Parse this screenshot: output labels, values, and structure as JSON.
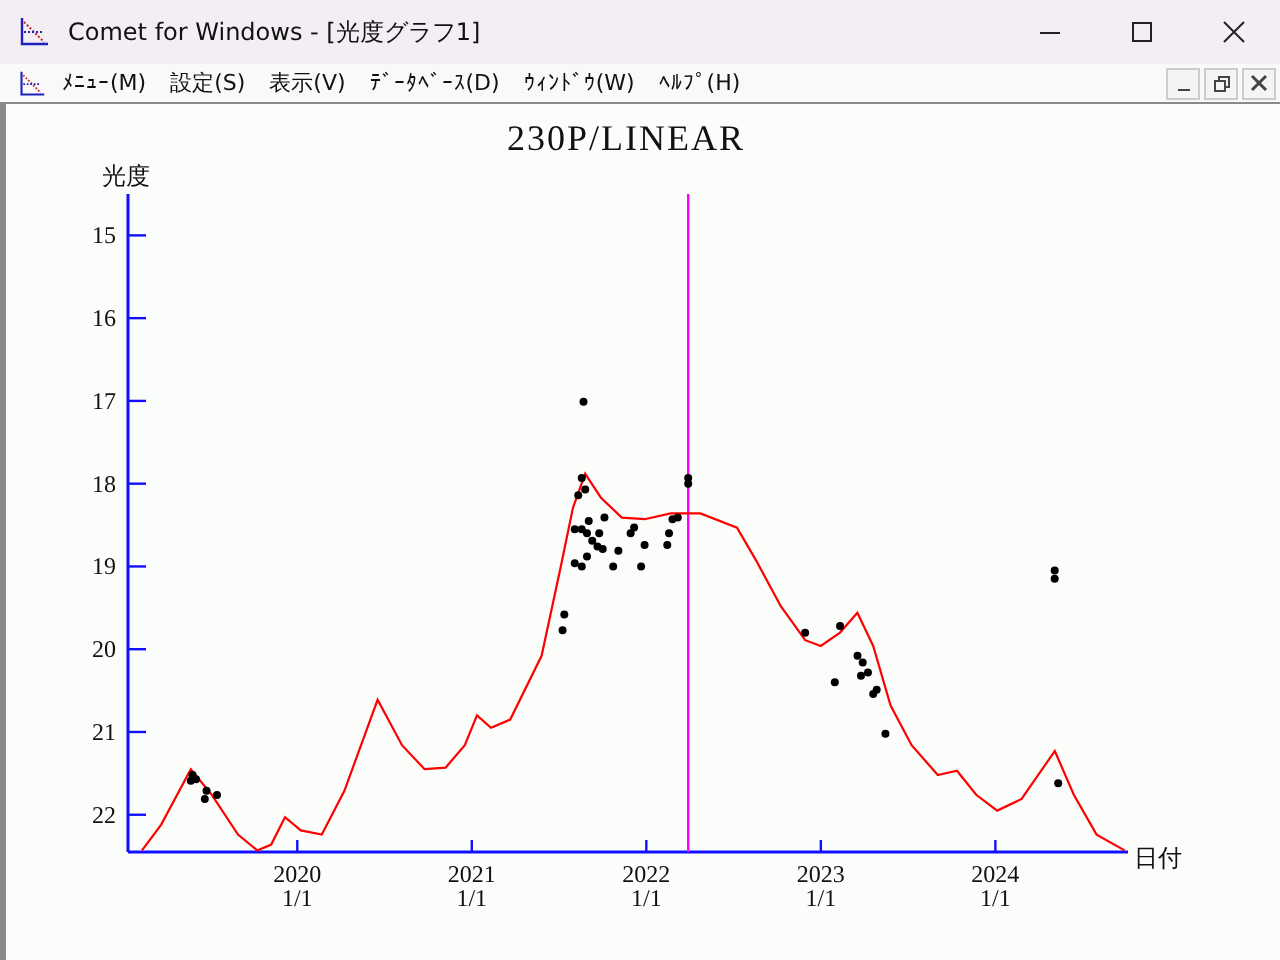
{
  "window": {
    "title": "Comet for Windows - [光度グラフ1]"
  },
  "menu": [
    "ﾒﾆｭｰ(M)",
    "設定(S)",
    "表示(V)",
    "ﾃﾞｰﾀﾍﾞｰｽ(D)",
    "ｳｨﾝﾄﾞｳ(W)",
    "ﾍﾙﾌﾟ(H)"
  ],
  "graph": {
    "chart_data": {
      "type": "line",
      "title": "230P/LINEAR",
      "ylabel": "光度",
      "xlabel": "日付",
      "xlim": [
        2019.03,
        2024.76
      ],
      "ylim": [
        22.45,
        14.5
      ],
      "xticks": [
        2020,
        2021,
        2022,
        2023,
        2024
      ],
      "yticks": [
        15,
        16,
        17,
        18,
        19,
        20,
        21,
        22
      ],
      "series": [
        {
          "color": "#ff0000",
          "x": [
            2019.11,
            2019.22,
            2019.39,
            2019.51,
            2019.66,
            2019.77,
            2019.85,
            2019.93,
            2020.02,
            2020.14,
            2020.27,
            2020.46,
            2020.6,
            2020.73,
            2020.85,
            2020.96,
            2021.03,
            2021.11,
            2021.22,
            2021.4,
            2021.51,
            2021.58,
            2021.65,
            2021.74,
            2021.86,
            2021.99,
            2022.14,
            2022.31,
            2022.52,
            2022.63,
            2022.77,
            2022.91,
            2023.0,
            2023.11,
            2023.21,
            2023.3,
            2023.4,
            2023.52,
            2023.67,
            2023.78,
            2023.89,
            2024.01,
            2024.15,
            2024.34,
            2024.45,
            2024.58,
            2024.74
          ],
          "values": [
            22.43,
            22.12,
            21.45,
            21.76,
            22.24,
            22.43,
            22.36,
            22.03,
            22.19,
            22.24,
            21.71,
            20.61,
            21.16,
            21.45,
            21.43,
            21.16,
            20.8,
            20.95,
            20.85,
            20.08,
            19.0,
            18.29,
            17.88,
            18.17,
            18.41,
            18.43,
            18.36,
            18.36,
            18.53,
            18.93,
            19.48,
            19.89,
            19.96,
            19.8,
            19.56,
            19.96,
            20.68,
            21.16,
            21.52,
            21.47,
            21.76,
            21.95,
            21.81,
            21.23,
            21.76,
            22.24,
            22.43
          ]
        },
        {
          "type": "scatter",
          "color": "#000000",
          "x": [
            2019.4,
            2019.42,
            2019.39,
            2019.48,
            2019.47,
            2019.54,
            2021.64,
            2021.61,
            2021.65,
            2021.63,
            2021.59,
            2021.63,
            2021.66,
            2021.67,
            2021.69,
            2021.73,
            2021.76,
            2021.59,
            2021.63,
            2021.66,
            2021.72,
            2021.75,
            2021.81,
            2021.84,
            2021.91,
            2021.93,
            2021.97,
            2021.99,
            2022.12,
            2022.13,
            2022.15,
            2022.18,
            2022.24,
            2022.24,
            2021.52,
            2021.53,
            2022.91,
            2023.11,
            2023.08,
            2023.21,
            2023.23,
            2023.24,
            2023.27,
            2023.3,
            2023.32,
            2023.37,
            2024.34,
            2024.34,
            2024.36
          ],
          "values": [
            21.52,
            21.57,
            21.59,
            21.71,
            21.81,
            21.76,
            17.01,
            18.14,
            18.07,
            17.93,
            18.55,
            18.55,
            18.6,
            18.45,
            18.69,
            18.6,
            18.41,
            18.96,
            19.0,
            18.88,
            18.76,
            18.79,
            19.0,
            18.81,
            18.6,
            18.53,
            19.0,
            18.74,
            18.74,
            18.6,
            18.43,
            18.41,
            17.93,
            18.0,
            19.77,
            19.58,
            19.8,
            19.72,
            20.4,
            20.08,
            20.32,
            20.16,
            20.28,
            20.54,
            20.49,
            21.02,
            19.05,
            19.15,
            21.62
          ]
        }
      ],
      "ref_lines": [
        {
          "axis": "x",
          "value": 2022.24
        }
      ],
      "annotations": [
        "1/1",
        "1/1",
        "1/1",
        "1/1",
        "1/1"
      ]
    }
  }
}
